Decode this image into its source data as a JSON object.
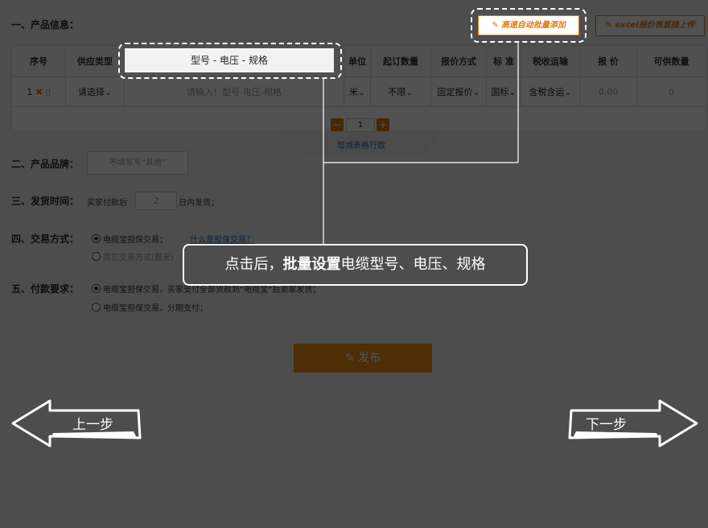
{
  "sections": {
    "product_info": "一、产品信息：",
    "brand": "二、产品品牌：",
    "ship": "三、发货时间：",
    "trade": "四、交易方式：",
    "pay": "五、付款要求："
  },
  "buttons": {
    "auto_batch_add": "高速自动批量添加",
    "excel_upload": "excel报价表直接上传",
    "publish": "发布",
    "prev": "上一步",
    "next": "下一步"
  },
  "table": {
    "headers": [
      "序号",
      "供应类型",
      "型号 - 电压 - 规格",
      "单位",
      "起订数量",
      "报价方式",
      "标 准",
      "税收运输",
      "报 价",
      "可供数量"
    ],
    "row": {
      "index": "1",
      "supply_type": "请选择",
      "spec_placeholder": "请输入！型号-电压-规格",
      "unit": "米",
      "min_order": "不限",
      "price_mode": "固定报价",
      "standard": "国标",
      "tax": "含税含运",
      "price": "0.00",
      "qty": "0"
    },
    "row_counter": {
      "minus": "−",
      "value": "1",
      "plus": "+",
      "label": "增减表格行数"
    }
  },
  "brand": {
    "placeholder": "不填写写“其他”"
  },
  "ship": {
    "prefix": "买家付款后",
    "days": "2",
    "suffix": "日内发货；"
  },
  "trade": {
    "option1": "电缆宝担保交易；",
    "link": "什么是担保交易？",
    "option2": "其它交易方式(暂无)"
  },
  "pay": {
    "option1": "电缆宝担保交易，买家支付全部货款到“电缆宝”后卖家发货；",
    "option2": "电缆宝担保交易，分期支付；"
  },
  "callout": {
    "pre": "点击后，",
    "bold": "批量设置",
    "post": "电缆型号、电压、规格"
  },
  "colors": {
    "accent": "#e07a10",
    "overlay": "#4f4f4f"
  }
}
